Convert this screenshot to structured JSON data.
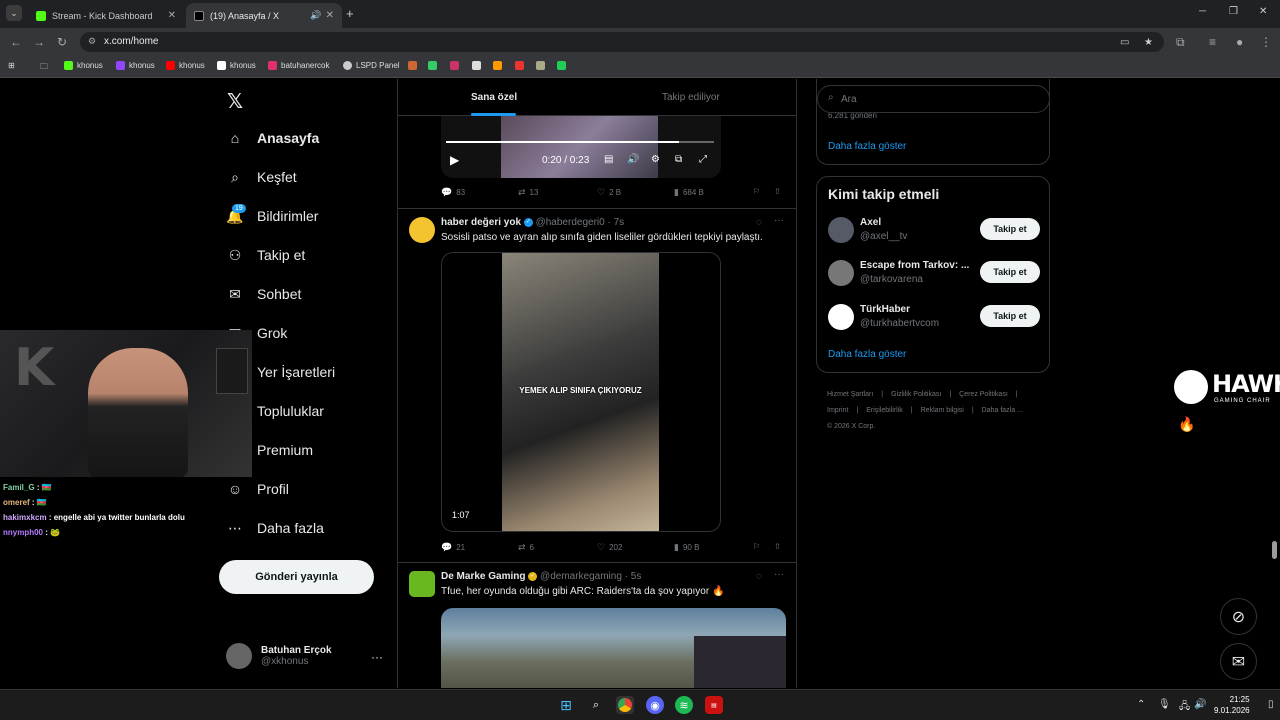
{
  "browser": {
    "tabs": [
      {
        "title": "Stream - Kick Dashboard",
        "favicon_color": "#53fc18"
      },
      {
        "title": "(19) Anasayfa / X",
        "favicon_color": "#ffffff"
      }
    ],
    "url": "x.com/home",
    "bookmarks": [
      {
        "label": "khonus",
        "color": "#53fc18"
      },
      {
        "label": "khonus",
        "color": "#9146ff"
      },
      {
        "label": "khonus",
        "color": "#ff0000"
      },
      {
        "label": "khonus",
        "color": "#ffffff"
      },
      {
        "label": "batuhanercok",
        "color": "#e1306c"
      },
      {
        "label": "LSPD Panel",
        "color": "#cccccc"
      }
    ]
  },
  "x": {
    "nav": [
      {
        "label": "Anasayfa",
        "icon": "home-icon",
        "glyph": "⌂"
      },
      {
        "label": "Keşfet",
        "icon": "search-icon",
        "glyph": "⌕"
      },
      {
        "label": "Bildirimler",
        "icon": "bell-icon",
        "glyph": "🔔"
      },
      {
        "label": "Takip et",
        "icon": "add-user-icon",
        "glyph": "⚇"
      },
      {
        "label": "Sohbet",
        "icon": "mail-icon",
        "glyph": "✉"
      },
      {
        "label": "Grok",
        "icon": "grok-icon",
        "glyph": "◪"
      },
      {
        "label": "Yer İşaretleri",
        "icon": "bookmark-icon",
        "glyph": "⚑"
      },
      {
        "label": "Topluluklar",
        "icon": "communities-icon",
        "glyph": "⚉"
      },
      {
        "label": "Premium",
        "icon": "premium-icon",
        "glyph": "✕"
      },
      {
        "label": "Profil",
        "icon": "profile-icon",
        "glyph": "☺"
      },
      {
        "label": "Daha fazla",
        "icon": "more-circle-icon",
        "glyph": "⋯"
      }
    ],
    "notification_count": "19",
    "post_button": "Gönderi yayınla",
    "user": {
      "name": "Batuhan Erçok",
      "handle": "@xkhonus"
    },
    "feed_tabs": {
      "active": "Sana özel",
      "inactive": "Takip ediliyor"
    },
    "tweet1": {
      "video_time": "0:20 / 0:23",
      "progress": 0.87,
      "replies": "83",
      "reposts": "13",
      "likes": "2 B",
      "views": "684 B"
    },
    "tweet2": {
      "name": "haber değeri yok",
      "handle": "@haberdegeri0 · 7s",
      "text": "Sosisli patso ve ayran alıp sınıfa giden liseliler gördükleri tepkiyi paylaştı.",
      "caption": "YEMEK ALIP SINIFA ÇIKIYORUZ",
      "duration": "1:07",
      "replies": "21",
      "reposts": "6",
      "likes": "202",
      "views": "90 B"
    },
    "tweet3": {
      "name": "De Marke Gaming",
      "handle": "@demarkegaming · 5s",
      "text": "Tfue, her oyunda olduğu gibi ARC: Raiders'ta da şov yapıyor 🔥"
    },
    "search_placeholder": "Ara",
    "trend_tail": "6.281 gönderi",
    "show_more": "Daha fazla göster",
    "who_to_follow": {
      "title": "Kimi takip etmeli",
      "follow_label": "Takip et",
      "accounts": [
        {
          "name": "Axel",
          "handle": "@axel__tv",
          "color": "#555a66"
        },
        {
          "name": "Escape from Tarkov: ...",
          "handle": "@tarkovarena",
          "color": "#777777"
        },
        {
          "name": "TürkHaber",
          "handle": "@turkhabertvcom",
          "color": "#ffffff"
        }
      ]
    },
    "footer": [
      "Hizmet Şartları",
      "|",
      "Gizlilik Politikası",
      "|",
      "Çerez Politikası",
      "|",
      "Imprint",
      "|",
      "Erişilebilirlik",
      "|",
      "Reklam bilgisi",
      "|",
      "Daha fazla ...",
      "© 2026 X Corp."
    ]
  },
  "stream_chat": [
    {
      "user": "Famil_G",
      "text": ": 🇦🇿"
    },
    {
      "user": "omeref",
      "text": ": 🇦🇿"
    },
    {
      "user": "hakimxkcm",
      "text": ": engelle abi ya twitter bunlarla dolu"
    },
    {
      "user": "nnymph00",
      "text": ": 🐸"
    }
  ],
  "sponsor": {
    "brand": "HAWK",
    "sub": "GAMING CHAIR"
  },
  "clock": {
    "time": "21:25",
    "date": "9.01.2026"
  },
  "colors": {
    "accent": "#1d9bf0",
    "background": "#000000",
    "text": "#e7e9ea",
    "muted": "#71767b"
  }
}
